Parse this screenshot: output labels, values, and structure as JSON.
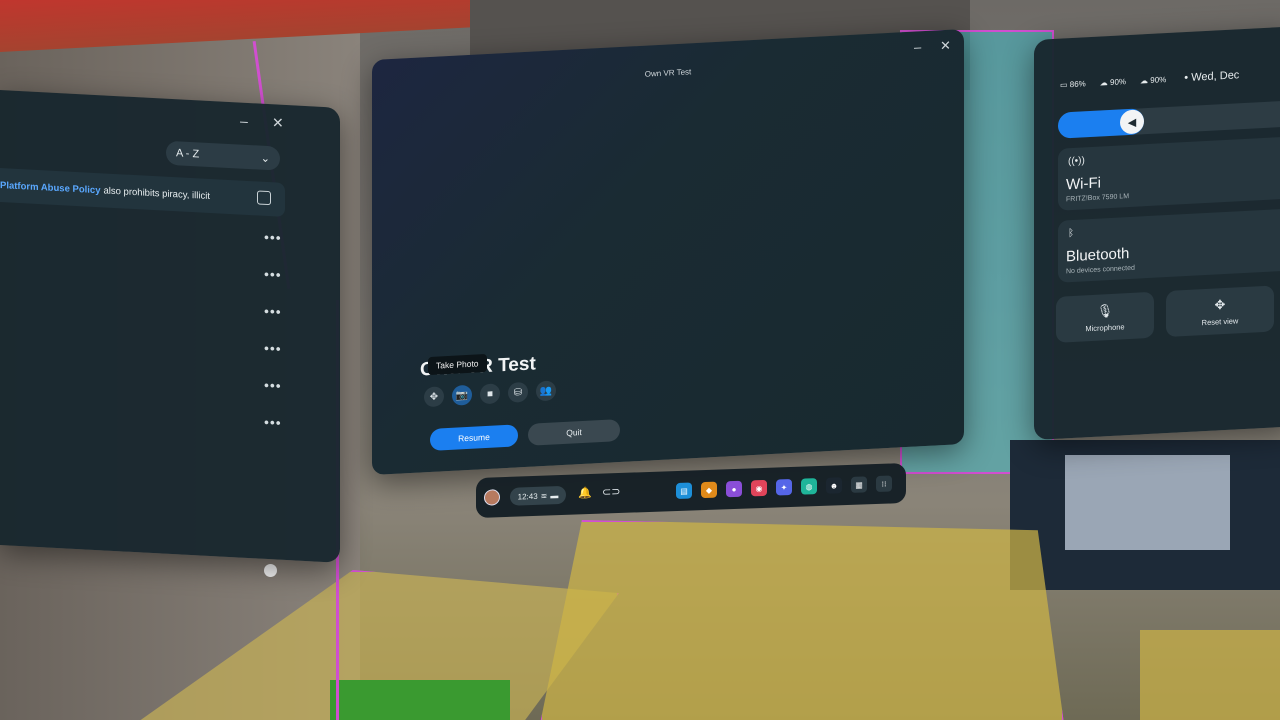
{
  "left_panel": {
    "sort_value": "A - Z",
    "policy_link": "Platform Abuse Policy",
    "policy_text": "also prohibits piracy, illicit",
    "row_menus": [
      "•••",
      "•••",
      "•••",
      "•••",
      "•••",
      "•••"
    ],
    "minimize": "–",
    "close": "✕"
  },
  "center_panel": {
    "window_title": "Own VR Test",
    "game_title": "Own VR Test",
    "tooltip": "Take Photo",
    "resume_label": "Resume",
    "quit_label": "Quit",
    "minimize": "–",
    "close": "✕",
    "tools": [
      "✥",
      "📷",
      "■",
      "⛁",
      "👥"
    ]
  },
  "quick_settings": {
    "battery": "86%",
    "controller_left": "90%",
    "controller_right": "90%",
    "date": "Wed, Dec",
    "volume_level": 0.3,
    "wifi_title": "Wi-Fi",
    "wifi_network": "FRITZ!Box 7590 LM",
    "bt_title": "Bluetooth",
    "bt_status": "No devices connected",
    "mic_label": "Microphone",
    "reset_label": "Reset view"
  },
  "taskbar": {
    "time": "12:43",
    "apps": [
      {
        "icon": "library-icon",
        "color": "#1d8fd8",
        "glyph": "▤"
      },
      {
        "icon": "store-icon",
        "color": "#e08a1a",
        "glyph": "◆"
      },
      {
        "icon": "people-icon",
        "color": "#8a4ed8",
        "glyph": "●"
      },
      {
        "icon": "camera-icon",
        "color": "#e0445a",
        "glyph": "◉"
      },
      {
        "icon": "messenger-icon",
        "color": "#5566e8",
        "glyph": "✦"
      },
      {
        "icon": "horizon-icon",
        "color": "#1fb59a",
        "glyph": "◍"
      },
      {
        "icon": "game-icon",
        "color": "#1b2630",
        "glyph": "☻"
      },
      {
        "icon": "multitask-icon",
        "color": "#2b3a42",
        "glyph": "▦"
      },
      {
        "icon": "all-apps-icon",
        "color": "#2b3a42",
        "glyph": "⁝⁝"
      }
    ]
  }
}
